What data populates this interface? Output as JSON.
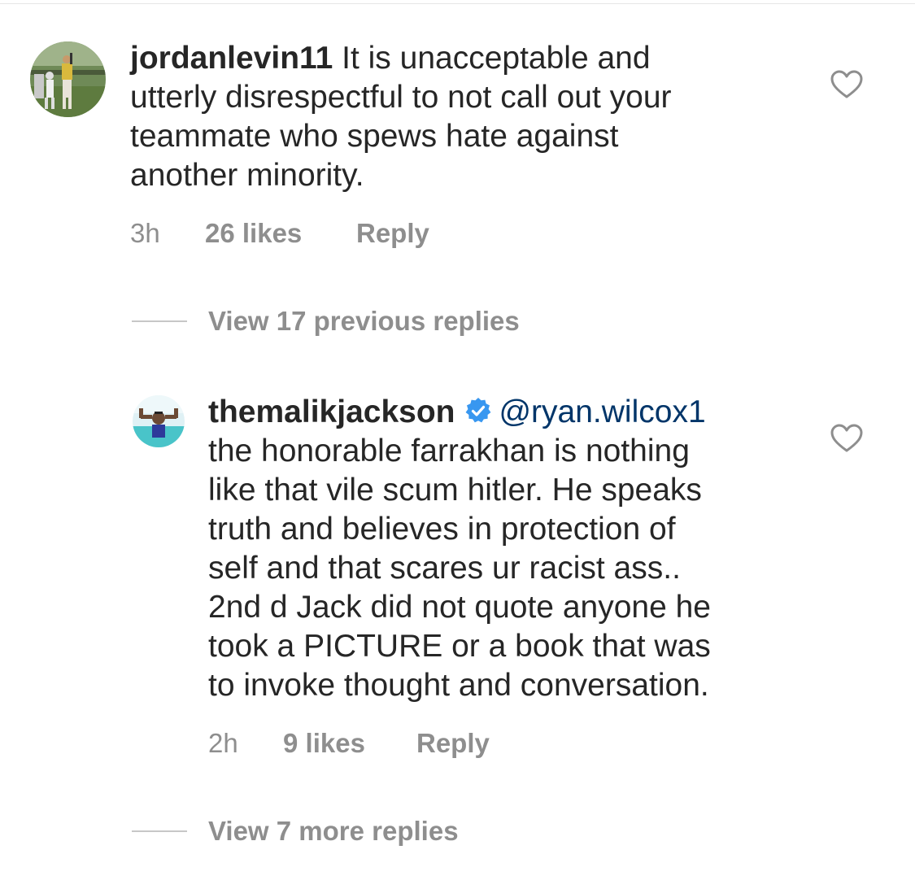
{
  "comments": [
    {
      "username": "jordanlevin11",
      "lines": [
        "It is unacceptable and",
        "utterly disrespectful to not call out your",
        "teammate who spews hate against",
        "another minority."
      ],
      "time": "3h",
      "likes": "26 likes",
      "reply": "Reply",
      "avatar_icon": "baseball-player-photo",
      "like_icon": "heart-outline-icon"
    },
    {
      "username": "themalikjackson",
      "verified": true,
      "mention": "@ryan.wilcox1",
      "lines": [
        "the honorable farrakhan is nothing",
        "like that vile scum hitler. He speaks",
        "truth and believes in protection of",
        "self and that scares ur racist ass..",
        "2nd d Jack did not quote anyone he",
        "took a PICTURE or a book that was",
        "to invoke thought and conversation."
      ],
      "time": "2h",
      "likes": "9 likes",
      "reply": "Reply",
      "avatar_icon": "person-flexing-photo",
      "like_icon": "heart-outline-icon"
    }
  ],
  "view_previous": "View 17 previous replies",
  "view_more": "View 7 more replies",
  "colors": {
    "text": "#262626",
    "meta": "#8e8e8e",
    "mention": "#003569",
    "verified": "#3897f0"
  }
}
